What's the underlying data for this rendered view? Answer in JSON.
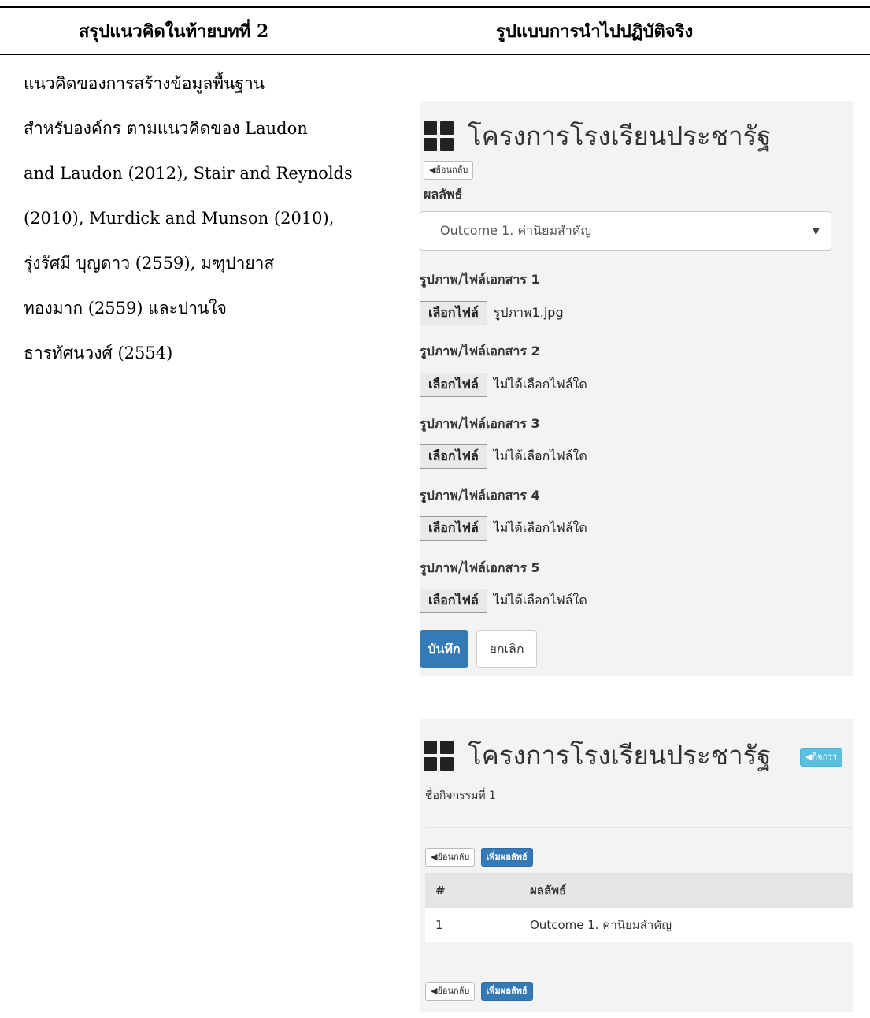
{
  "header": {
    "left": "สรุปแนวคิดในท้ายบทที่ 2",
    "right": "รูปแบบการนำไปปฏิบัติจริง"
  },
  "left_column": {
    "lines": [
      "แนวคิดของการสร้างข้อมูลพื้นฐาน",
      "สำหรับองค์กร ตามแนวคิดของ Laudon",
      "and Laudon (2012), Stair and Reynolds",
      "(2010), Murdick and Munson (2010),",
      "รุ่งรัศมี บุญดาว (2559), มฑุปายาส",
      "ทองมาก (2559) และปานใจ",
      "ธารทัศนวงศ์ (2554)"
    ]
  },
  "form_screen": {
    "title": "โครงการโรงเรียนประชารัฐ",
    "back_label": "◀ย้อนกลับ",
    "outcome_label": "ผลลัพธ์",
    "outcome_selected": "Outcome 1. ค่านิยมสำคัญ",
    "files": [
      {
        "label": "รูปภาพ/ไฟล์เอกสาร 1",
        "button": "เลือกไฟล์",
        "value": "รูปภาพ1.jpg"
      },
      {
        "label": "รูปภาพ/ไฟล์เอกสาร 2",
        "button": "เลือกไฟล์",
        "value": "ไม่ได้เลือกไฟล์ใด"
      },
      {
        "label": "รูปภาพ/ไฟล์เอกสาร 3",
        "button": "เลือกไฟล์",
        "value": "ไม่ได้เลือกไฟล์ใด"
      },
      {
        "label": "รูปภาพ/ไฟล์เอกสาร 4",
        "button": "เลือกไฟล์",
        "value": "ไม่ได้เลือกไฟล์ใด"
      },
      {
        "label": "รูปภาพ/ไฟล์เอกสาร 5",
        "button": "เลือกไฟล์",
        "value": "ไม่ได้เลือกไฟล์ใด"
      }
    ],
    "save_label": "บันทึก",
    "cancel_label": "ยกเลิก"
  },
  "list_screen": {
    "title": "โครงการโรงเรียนประชารัฐ",
    "activity_button": "◀กิจกรร",
    "activity_name": "ชื่อกิจกรรมที่ 1",
    "back_label": "◀ย้อนกลับ",
    "add_label": "เพิ่มผลลัพธ์",
    "table": {
      "headers": [
        "#",
        "ผลลัพธ์"
      ],
      "rows": [
        [
          "1",
          "Outcome 1. ค่านิยมสำคัญ"
        ]
      ]
    }
  }
}
